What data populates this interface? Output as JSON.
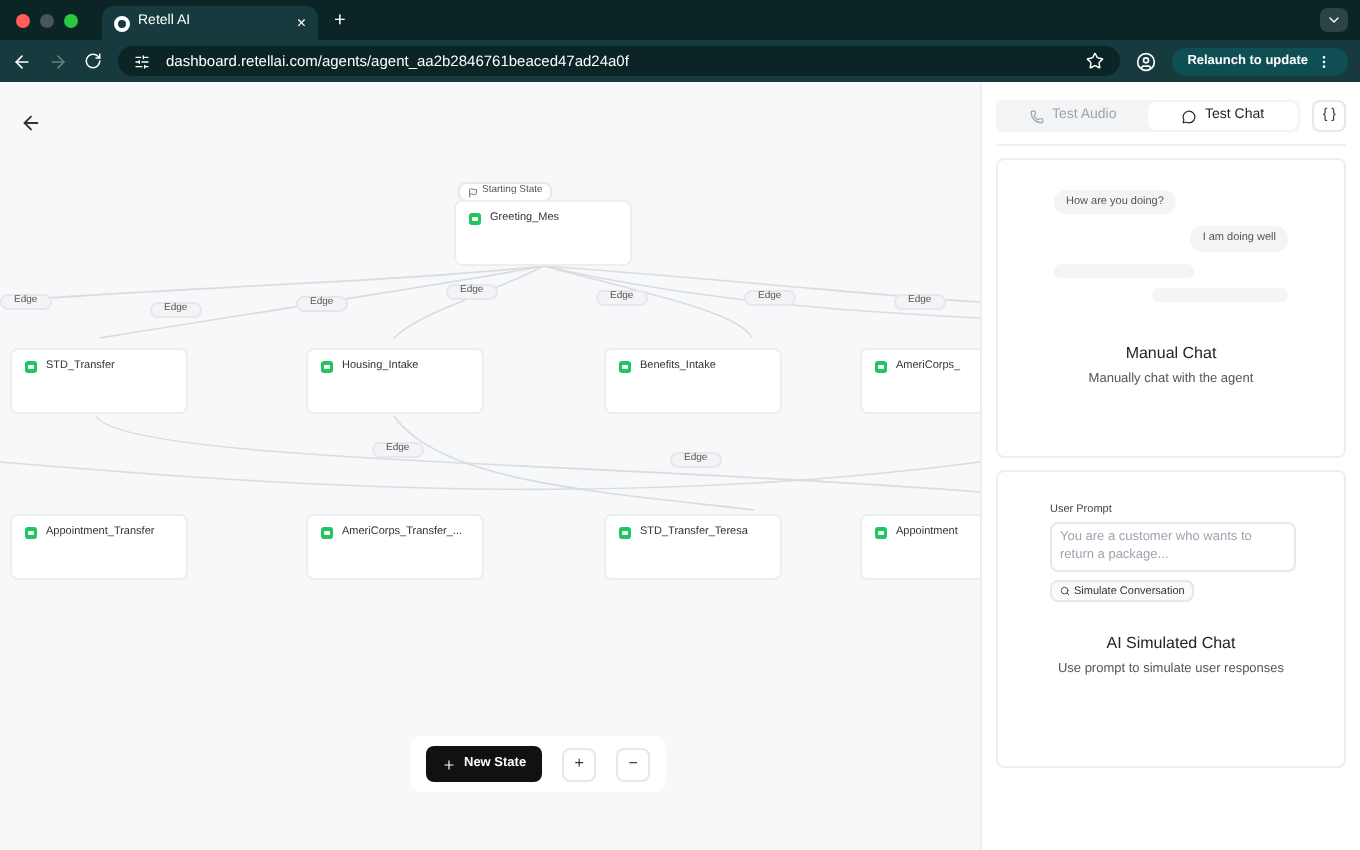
{
  "browser": {
    "tab": {
      "title": "Retell AI",
      "close": "×"
    },
    "new_tab": "+",
    "url": "dashboard.retellai.com/agents/agent_aa2b2846761beaced47ad24a0f",
    "relaunch_button": "Relaunch to update"
  },
  "canvas": {
    "start_label": "Starting State",
    "nodes": [
      {
        "name": "Greeting_Mes"
      },
      {
        "name": "STD_Transfer"
      },
      {
        "name": "Housing_Intake"
      },
      {
        "name": "Benefits_Intake"
      },
      {
        "name": "AmeriCorps_"
      },
      {
        "name": "Appointment_Transfer"
      },
      {
        "name": "AmeriCorps_Transfer_..."
      },
      {
        "name": "STD_Transfer_Teresa"
      },
      {
        "name": "Appointment"
      }
    ],
    "edges": [
      "Edge",
      "Edge",
      "Edge",
      "Edge",
      "Edge",
      "Edge",
      "Edge",
      "Edge",
      "Edge"
    ],
    "toolbar": {
      "new_state": "New State",
      "zoom_in": "+",
      "zoom_out": "−"
    }
  },
  "panel": {
    "tabs": [
      {
        "label": "Test Audio",
        "selected": false
      },
      {
        "label": "Test Chat",
        "selected": true
      }
    ],
    "vars_button": "{ }",
    "manual_card": {
      "bubbles": [
        {
          "text": "How are you doing?",
          "kind": "incoming"
        },
        {
          "text": "I am doing well",
          "kind": "outgoing"
        }
      ],
      "title": "Manual Chat",
      "subtitle": "Manually chat with the agent"
    },
    "sim_card": {
      "label": "User Prompt",
      "placeholder": "You are a customer who wants to return a package...",
      "button": "Simulate Conversation",
      "title": "AI Simulated Chat",
      "subtitle": "Use prompt to simulate user responses"
    }
  }
}
